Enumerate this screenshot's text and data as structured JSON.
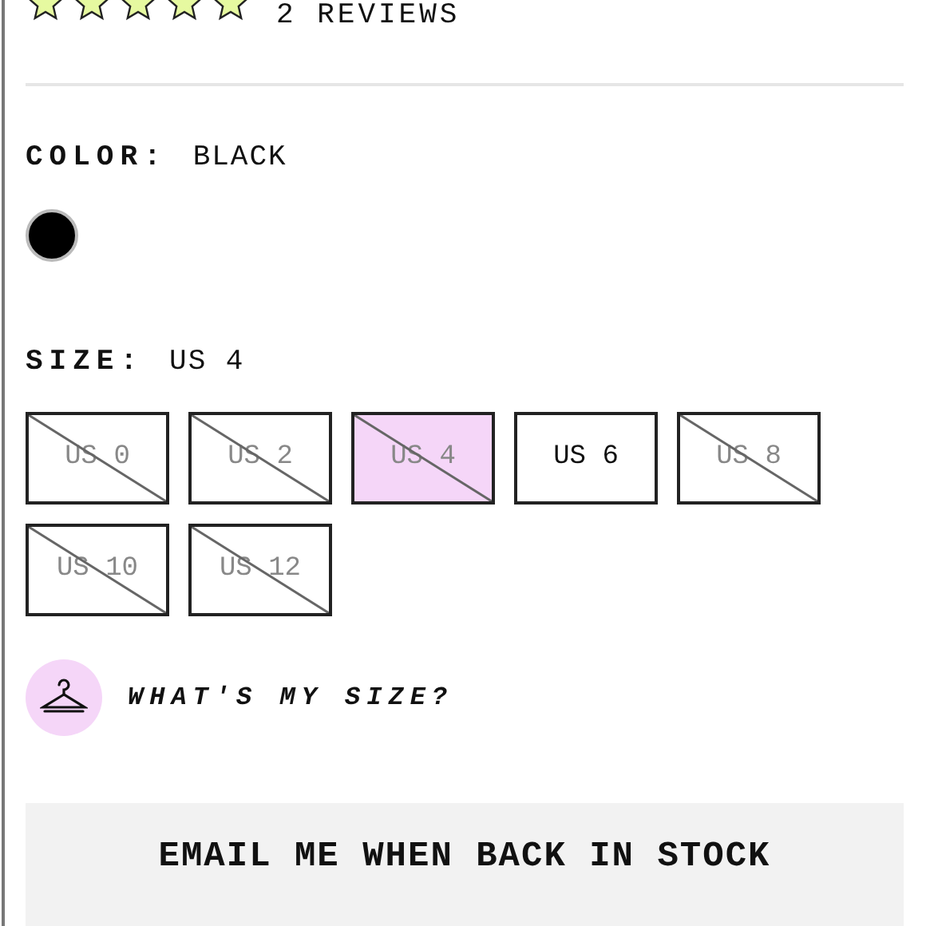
{
  "rating": {
    "stars": 5,
    "reviews": "2 REVIEWS"
  },
  "color": {
    "label": "COLOR:",
    "value": "BLACK",
    "swatches": [
      {
        "color": "#000000",
        "selected": true
      }
    ]
  },
  "size": {
    "label": "SIZE:",
    "value": "US 4",
    "options": [
      {
        "label": "US 0",
        "sold_out": true,
        "selected": false
      },
      {
        "label": "US 2",
        "sold_out": true,
        "selected": false
      },
      {
        "label": "US 4",
        "sold_out": true,
        "selected": true
      },
      {
        "label": "US 6",
        "sold_out": false,
        "selected": false
      },
      {
        "label": "US 8",
        "sold_out": true,
        "selected": false
      },
      {
        "label": "US 10",
        "sold_out": true,
        "selected": false
      },
      {
        "label": "US 12",
        "sold_out": true,
        "selected": false
      }
    ]
  },
  "size_guide": {
    "label": "WHAT'S MY SIZE?"
  },
  "notify_button": {
    "label": "EMAIL ME WHEN BACK IN STOCK"
  }
}
